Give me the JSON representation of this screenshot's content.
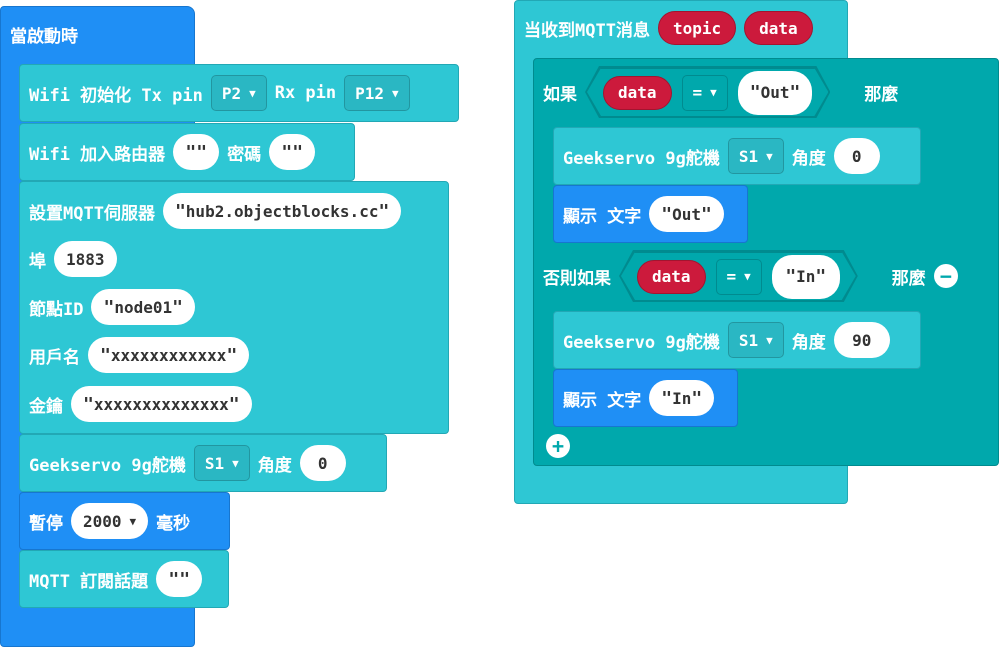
{
  "colors": {
    "hat_blue": "#1f8ff5",
    "block_cyan": "#2ec7d4",
    "logic_teal": "#00a8ac",
    "variable_red": "#cc1a3c"
  },
  "left": {
    "start_label": "當啟動時",
    "wifi_init": {
      "label": "Wifi 初始化 Tx pin",
      "tx": "P2",
      "rx_label": "Rx pin",
      "rx": "P12"
    },
    "wifi_join": {
      "label": "Wifi 加入路由器",
      "ssid": "",
      "pwd_label": "密碼",
      "pwd": ""
    },
    "mqtt_setup": {
      "server_label": "設置MQTT伺服器",
      "server": "hub2.objectblocks.cc",
      "port_label": "埠",
      "port": "1883",
      "node_label": "節點ID",
      "node": "node01",
      "user_label": "用戶名",
      "user": "xxxxxxxxxxxx",
      "key_label": "金鑰",
      "key": "xxxxxxxxxxxxxx"
    },
    "servo": {
      "label": "Geekservo 9g舵機",
      "pin": "S1",
      "angle_label": "角度",
      "angle": "0"
    },
    "pause": {
      "label": "暫停",
      "value": "2000",
      "unit": "毫秒"
    },
    "subscribe": {
      "label": "MQTT 訂閱話題",
      "topic": ""
    }
  },
  "right": {
    "event_label": "当收到MQTT消息",
    "param_topic": "topic",
    "param_data": "data",
    "if_label": "如果",
    "then_label": "那麼",
    "elseif_label": "否則如果",
    "cond1": {
      "var": "data",
      "op": "=",
      "value": "Out"
    },
    "cond2": {
      "var": "data",
      "op": "=",
      "value": "In"
    },
    "servo1": {
      "label": "Geekservo 9g舵機",
      "pin": "S1",
      "angle_label": "角度",
      "angle": "0"
    },
    "show1": {
      "label": "顯示 文字",
      "value": "Out"
    },
    "servo2": {
      "label": "Geekservo 9g舵機",
      "pin": "S1",
      "angle_label": "角度",
      "angle": "90"
    },
    "show2": {
      "label": "顯示 文字",
      "value": "In"
    }
  },
  "icons": {
    "remove": "minus-circle-icon",
    "add": "plus-circle-icon",
    "dropdown": "caret-down-icon"
  }
}
